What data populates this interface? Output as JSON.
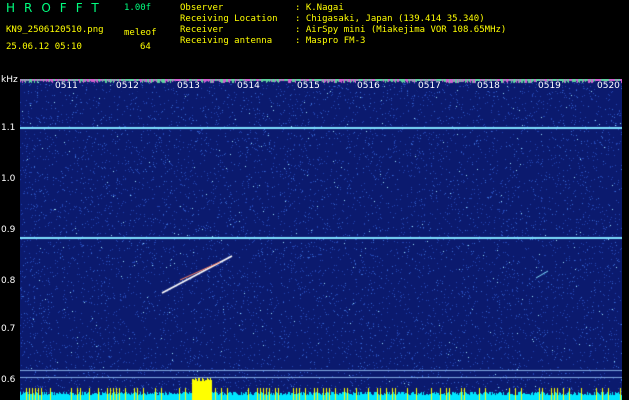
{
  "header": {
    "app_title": "HROFFT",
    "version": "1.00f",
    "filename": "KN9_2506120510.png",
    "datetime": "25.06.12 05:10",
    "param_label": "meleof",
    "param_value": "64",
    "info": [
      {
        "key": "Observer",
        "value": ": K.Nagai"
      },
      {
        "key": "Receiving Location",
        "value": ": Chigasaki, Japan (139.414 35.340)"
      },
      {
        "key": "Receiver",
        "value": ": AirSpy mini (Miakejima VOR 108.65MHz)"
      },
      {
        "key": "Receiving antenna",
        "value": ": Maspro FM-3"
      }
    ]
  },
  "spectrogram": {
    "y_unit": "kHz",
    "y_ticks": [
      "1.1",
      "1.0",
      "0.9",
      "0.8",
      "0.7",
      "0.6"
    ],
    "time_labels": [
      "0511",
      "0512",
      "0513",
      "0514",
      "0515",
      "0516",
      "0517",
      "0518",
      "0519",
      "0520"
    ],
    "colors": {
      "background": "#0b1a6e",
      "noise": "#3a6fd8",
      "carrier": "#7fe0ff",
      "meteor": "#ffffff",
      "level": "#ffff00",
      "baseline": "#00e5ff"
    }
  }
}
